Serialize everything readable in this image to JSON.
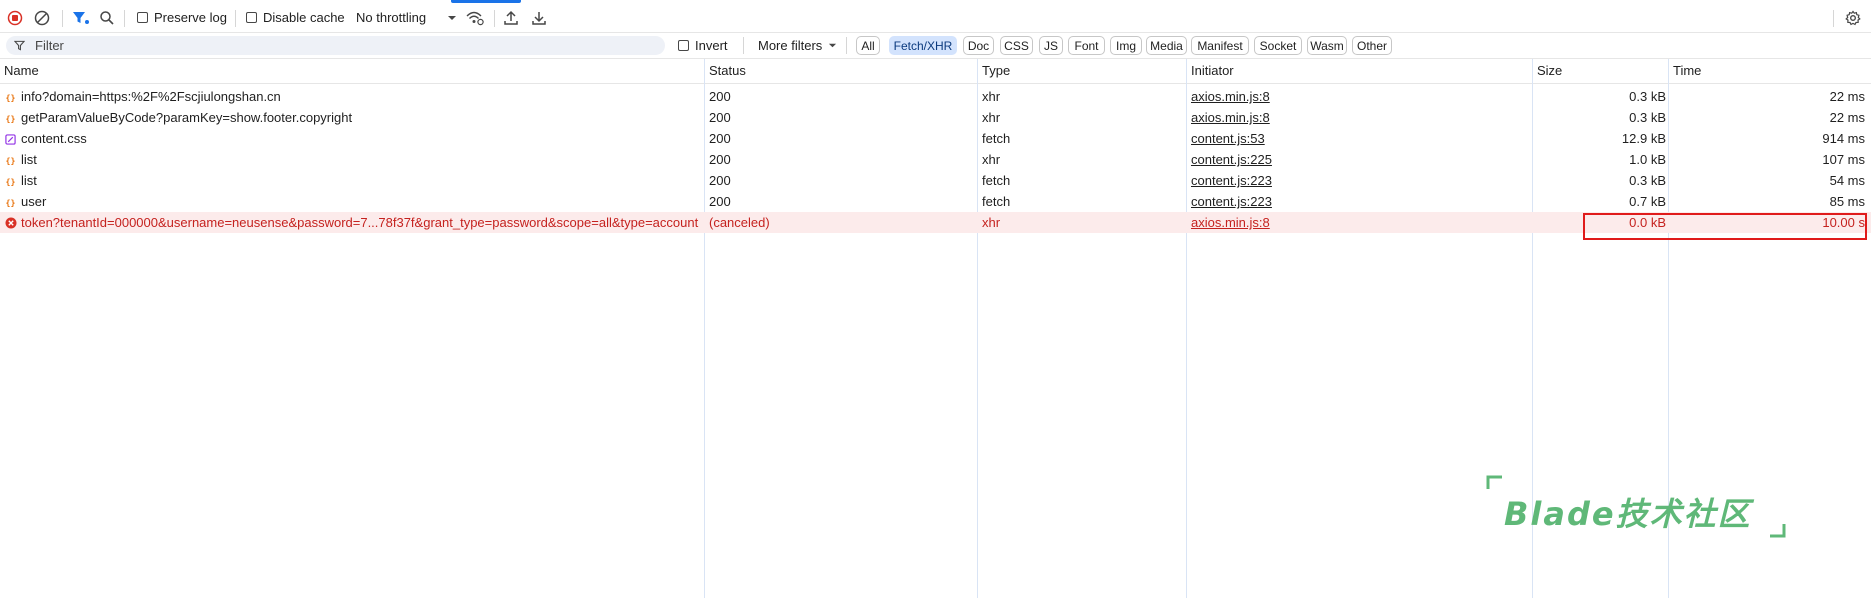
{
  "toolbar": {
    "preserve_log_label": "Preserve log",
    "disable_cache_label": "Disable cache",
    "throttling_value": "No throttling"
  },
  "filterbar": {
    "filter_placeholder": "Filter",
    "invert_label": "Invert",
    "more_filters_label": "More filters",
    "types": [
      "All",
      "Fetch/XHR",
      "Doc",
      "CSS",
      "JS",
      "Font",
      "Img",
      "Media",
      "Manifest",
      "Socket",
      "Wasm",
      "Other"
    ],
    "active_type": "Fetch/XHR"
  },
  "table": {
    "headers": {
      "name": "Name",
      "status": "Status",
      "type": "Type",
      "initiator": "Initiator",
      "size": "Size",
      "time": "Time"
    },
    "rows": [
      {
        "name": "info?domain=https:%2F%2Fscjiulongshan.cn",
        "status": "200",
        "type": "xhr",
        "initiator": "axios.min.js:8",
        "size": "0.3 kB",
        "time": "22 ms",
        "icon": "xhr-icon"
      },
      {
        "name": "getParamValueByCode?paramKey=show.footer.copyright",
        "status": "200",
        "type": "xhr",
        "initiator": "axios.min.js:8",
        "size": "0.3 kB",
        "time": "22 ms",
        "icon": "xhr-icon"
      },
      {
        "name": "content.css",
        "status": "200",
        "type": "fetch",
        "initiator": "content.js:53",
        "size": "12.9 kB",
        "time": "914 ms",
        "icon": "stylesheet-icon"
      },
      {
        "name": "list",
        "status": "200",
        "type": "xhr",
        "initiator": "content.js:225",
        "size": "1.0 kB",
        "time": "107 ms",
        "icon": "xhr-icon"
      },
      {
        "name": "list",
        "status": "200",
        "type": "fetch",
        "initiator": "content.js:223",
        "size": "0.3 kB",
        "time": "54 ms",
        "icon": "xhr-icon"
      },
      {
        "name": "user",
        "status": "200",
        "type": "fetch",
        "initiator": "content.js:223",
        "size": "0.7 kB",
        "time": "85 ms",
        "icon": "xhr-icon"
      },
      {
        "name": "token?tenantId=000000&username=neusense&password=7...78f37f&grant_type=password&scope=all&type=account",
        "status": "(canceled)",
        "type": "xhr",
        "initiator": "axios.min.js:8",
        "size": "0.0 kB",
        "time": "10.00 s",
        "icon": "error-icon"
      }
    ]
  },
  "watermark": {
    "text": "Blade技术社区"
  },
  "colors": {
    "accent": "#1a73e8",
    "error": "#c5221f",
    "error_bg": "#fcebeb",
    "highlight": "#e01b1b",
    "watermark": "#5fb878"
  }
}
